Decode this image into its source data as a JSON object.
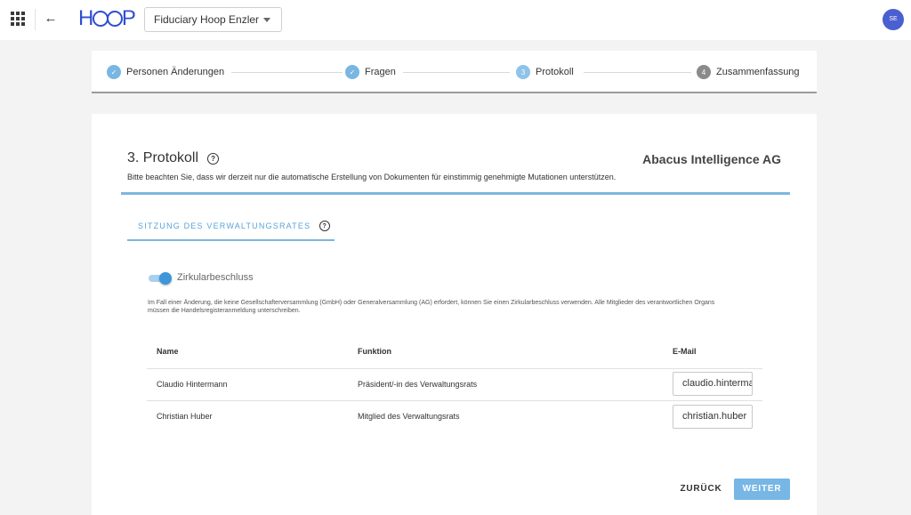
{
  "topbar": {
    "logo": "HOOP",
    "fiduciary_select": "Fiduciary Hoop Enzler",
    "avatar_initials": "SE"
  },
  "stepper": {
    "steps": [
      {
        "label": "Personen Änderungen",
        "state": "done",
        "marker": "✓"
      },
      {
        "label": "Fragen",
        "state": "done",
        "marker": "✓"
      },
      {
        "label": "Protokoll",
        "state": "active",
        "marker": "3"
      },
      {
        "label": "Zusammenfassung",
        "state": "pending",
        "marker": "4"
      }
    ]
  },
  "card": {
    "title": "3. Protokoll",
    "company": "Abacus Intelligence AG",
    "hint": "Bitte beachten Sie, dass wir derzeit nur die automatische Erstellung von Dokumenten für einstimmig genehmigte Mutationen unterstützen.",
    "tab_label": "SITZUNG DES VERWALTUNGSRATES",
    "toggle_label": "Zirkularbeschluss",
    "toggle_on": true,
    "paragraph": "Im Fall einer Änderung, die keine Gesellschafterversammlung (GmbH) oder Generalversammlung (AG) erfordert, können Sie einen Zirkularbeschluss verwenden. Alle Mitglieder des verantwortlichen Organs müssen die Handelsregisteranmeldung unterschreiben.",
    "table": {
      "headers": {
        "name": "Name",
        "function": "Funktion",
        "email": "E-Mail"
      },
      "rows": [
        {
          "name": "Claudio Hintermann",
          "function": "Präsident/-in des Verwaltungsrats",
          "email": "claudio.hintermann"
        },
        {
          "name": "Christian Huber",
          "function": "Mitglied des Verwaltungsrats",
          "email": "christian.huber"
        }
      ]
    },
    "buttons": {
      "back": "ZURÜCK",
      "next": "WEITER"
    }
  },
  "colors": {
    "accent": "#7cb6e0",
    "brand": "#2f4fd1",
    "avatar": "#4a5fd0"
  }
}
